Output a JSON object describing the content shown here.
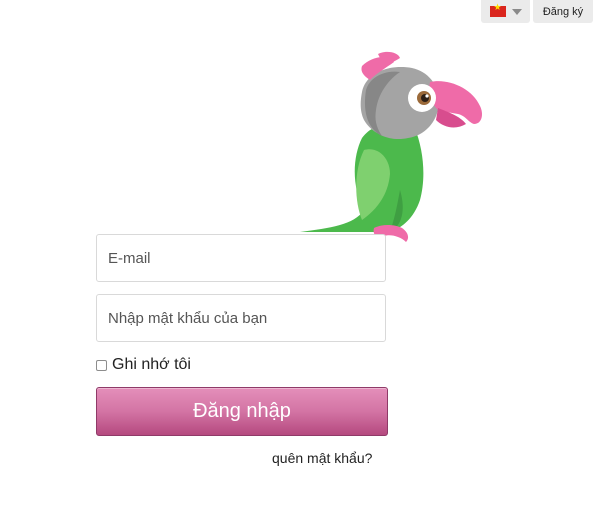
{
  "header": {
    "language_icon": "vietnam-flag-icon",
    "signup_label": "Đăng ký"
  },
  "login": {
    "email_placeholder": "E-mail",
    "password_placeholder": "Nhập mật khẩu của bạn",
    "remember_label": "Ghi nhớ tôi",
    "remember_checked": false,
    "submit_label": "Đăng nhập",
    "forgot_label": "quên mật khẩu?"
  },
  "colors": {
    "button_top": "#e48fba",
    "button_bottom": "#b5497f",
    "parrot_green": "#4cb94c",
    "parrot_pink": "#ef6ba8"
  }
}
